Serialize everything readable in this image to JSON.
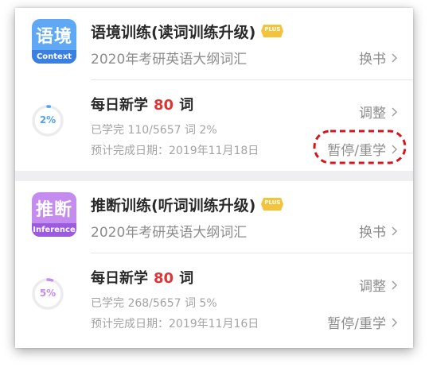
{
  "courses": [
    {
      "icon_cn": "语境",
      "icon_en": "Context",
      "icon_color_top": "#5fa8f5",
      "icon_color_band": "#3b7fe0",
      "title": "语境训练(读词训练升级)",
      "badge": "PLUS",
      "book": "2020年考研英语大纲词汇",
      "change_book": "换书",
      "daily_pre": "每日新学",
      "daily_count": "80",
      "daily_post": "词",
      "adjust": "调整",
      "progress_text": "已学完 110/5657 词 2%",
      "progress_pct": "2%",
      "progress_value": 0.02,
      "ring_color": "#4fa3f0",
      "eta_text": "预计完成日期：2019年11月18日",
      "pause_restart": "暂停/重学"
    },
    {
      "icon_cn": "推断",
      "icon_en": "Inference",
      "icon_color_top": "#c58cf0",
      "icon_color_band": "#9b5ae0",
      "title": "推断训练(听词训练升级)",
      "badge": "PLUS",
      "book": "2020年考研英语大纲词汇",
      "change_book": "换书",
      "daily_pre": "每日新学",
      "daily_count": "80",
      "daily_post": "词",
      "adjust": "调整",
      "progress_text": "已学完 268/5657 词 5%",
      "progress_pct": "5%",
      "progress_value": 0.05,
      "ring_color": "#c58cf0",
      "eta_text": "预计完成日期：2019年11月16日",
      "pause_restart": "暂停/重学"
    }
  ],
  "colors": {
    "annotation": "#d8141e",
    "badge": "#f5c33b"
  }
}
